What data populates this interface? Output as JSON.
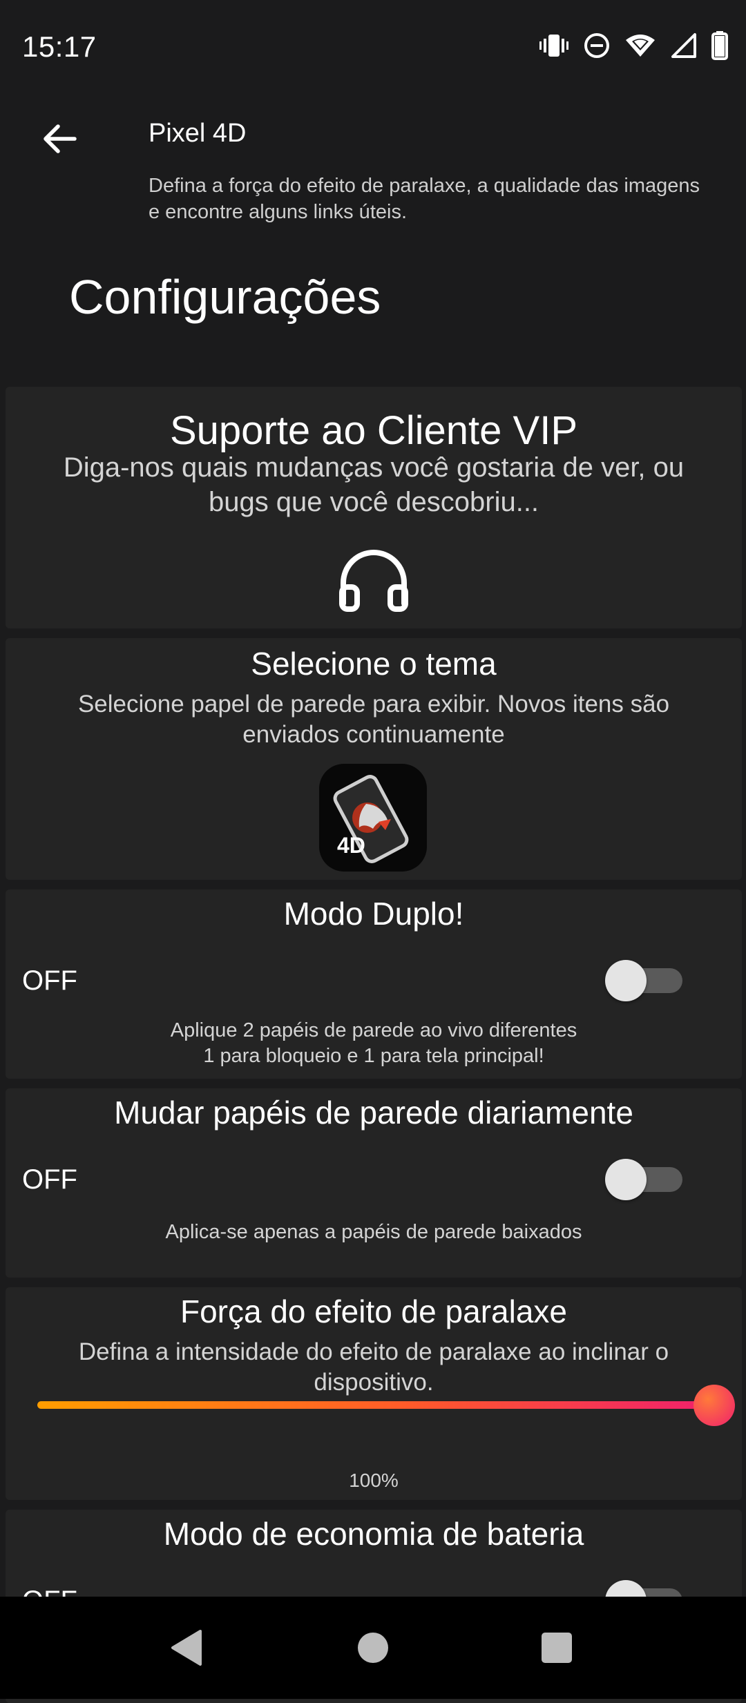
{
  "status_bar": {
    "time": "15:17",
    "icons": [
      "vibrate-icon",
      "do-not-disturb-icon",
      "wifi-icon",
      "signal-icon",
      "battery-icon"
    ]
  },
  "header": {
    "back_icon": "arrow-left-icon",
    "app_title": "Pixel 4D",
    "description": "Defina a força do efeito de paralaxe, a qualidade das imagens e encontre alguns links úteis.",
    "page_title": "Configurações"
  },
  "cards": {
    "vip_support": {
      "title": "Suporte ao Cliente VIP",
      "text": "Diga-nos quais mudanças você gostaria de ver, ou bugs que você descobriu...",
      "icon": "headphones-icon"
    },
    "theme": {
      "title": "Selecione o tema",
      "text": "Selecione papel de parede para exibir. Novos itens são enviados continuamente",
      "icon": "theme-thumbnail-icon",
      "icon_text": "4D"
    },
    "dual_mode": {
      "title": "Modo Duplo!",
      "state_label": "OFF",
      "enabled": false,
      "text_line1": "Aplique 2 papéis de parede ao vivo diferentes",
      "text_line2": "1 para bloqueio e 1 para tela principal!"
    },
    "daily_change": {
      "title": "Mudar papéis de parede diariamente",
      "state_label": "OFF",
      "enabled": false,
      "text": "Aplica-se apenas a papéis de parede baixados"
    },
    "parallax": {
      "title": "Força do efeito de paralaxe",
      "text": "Defina a intensidade do efeito de paralaxe ao inclinar o dispositivo.",
      "value": 1.0,
      "value_label": "100%",
      "gradient_colors": [
        "#ff9d00",
        "#f0206c"
      ]
    },
    "battery_saver": {
      "title": "Modo de economia de bateria",
      "state_label": "OFF",
      "enabled": false
    }
  },
  "nav_bar": {
    "icons": [
      "back-triangle-icon",
      "home-circle-icon",
      "recents-square-icon"
    ]
  },
  "colors": {
    "background": "#1b1b1c",
    "card": "#242424",
    "accent_start": "#ff9d00",
    "accent_end": "#f0206c"
  }
}
